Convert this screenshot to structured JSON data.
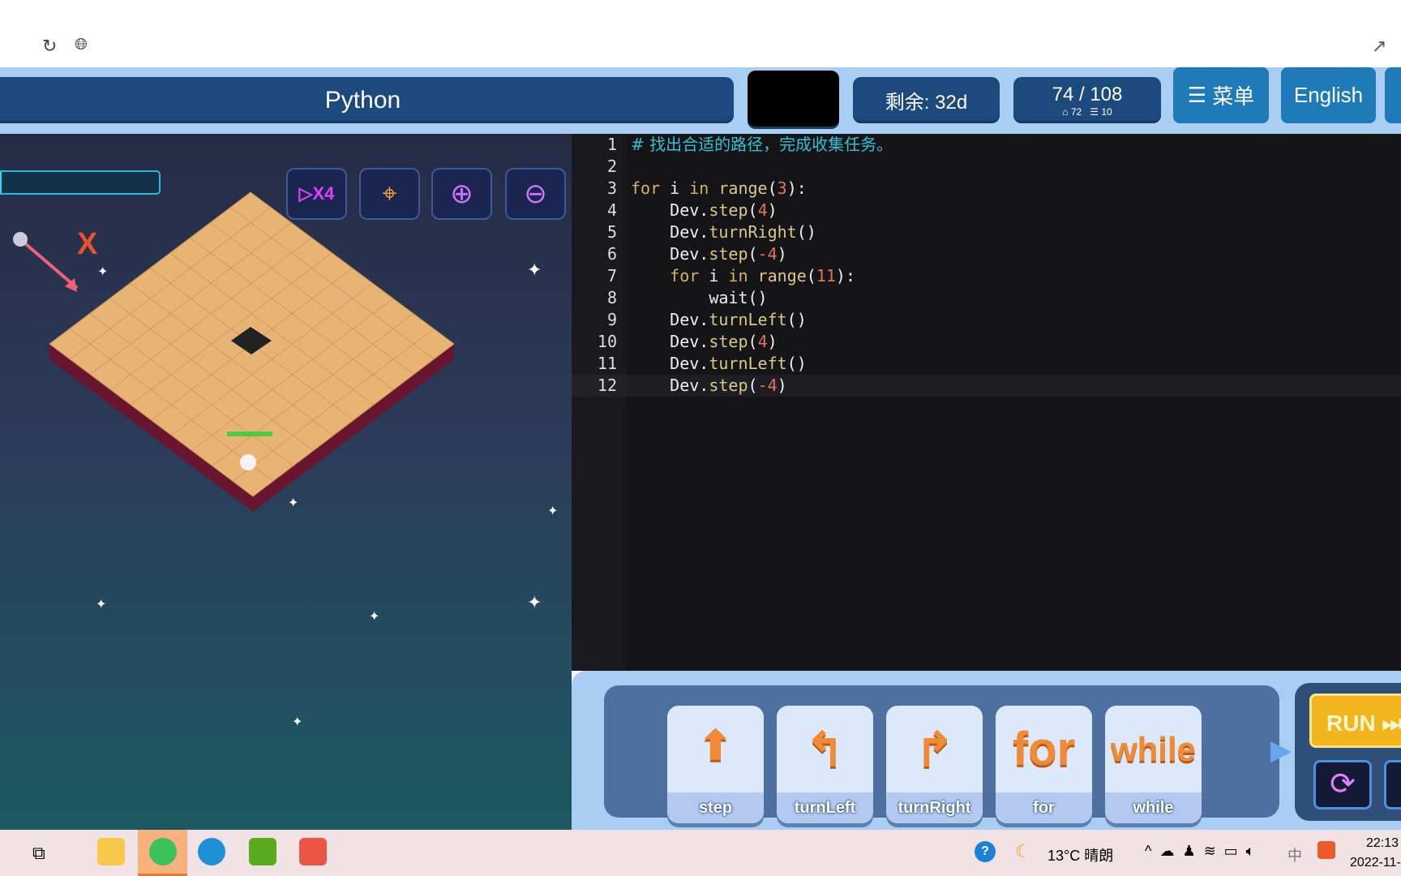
{
  "header": {
    "title": "Python",
    "remaining": "剩余: 32d",
    "progress": "74 / 108",
    "progress_sub_a": "72",
    "progress_sub_b": "10",
    "menu_label": "菜单",
    "language_label": "English"
  },
  "game": {
    "axis_label": "X",
    "speed_badge": "X4",
    "player_progress": 0.02
  },
  "editor": {
    "lines": [
      {
        "n": "1"
      },
      {
        "n": "2"
      },
      {
        "n": "3"
      },
      {
        "n": "4"
      },
      {
        "n": "5"
      },
      {
        "n": "6"
      },
      {
        "n": "7"
      },
      {
        "n": "8"
      },
      {
        "n": "9"
      },
      {
        "n": "10"
      },
      {
        "n": "11"
      },
      {
        "n": "12"
      }
    ],
    "comment": "# 找出合适的路径，完成收集任务。",
    "code": {
      "for": "for",
      "i": " i ",
      "in": "in",
      "range": " range",
      "dev": "Dev.",
      "step": "step",
      "turnRight": "turnRight",
      "turnLeft": "turnLeft",
      "wait": "wait",
      "n3": "3",
      "n4": "4",
      "nm4": "-4",
      "n11": "11"
    }
  },
  "blocks": [
    {
      "label": "step"
    },
    {
      "label": "turnLeft"
    },
    {
      "label": "turnRight"
    },
    {
      "label": "for",
      "big": "for"
    },
    {
      "label": "while",
      "big": "while"
    }
  ],
  "controls": {
    "run_label": "RUN"
  },
  "taskbar": {
    "weather": "13°C 晴朗",
    "ime": "中",
    "time": "22:13",
    "date": "2022-11-"
  },
  "colors": {
    "accent": "#1f7ab8",
    "header_bg": "#a9cdf3",
    "editor_bg": "#151417"
  }
}
